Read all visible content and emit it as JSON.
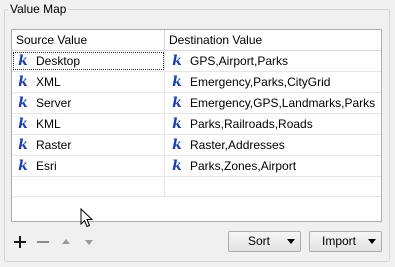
{
  "group": {
    "title": "Value Map"
  },
  "table": {
    "headers": {
      "source": "Source Value",
      "destination": "Destination Value"
    },
    "rows": [
      {
        "source": "Desktop",
        "destination": "GPS,Airport,Parks",
        "selected": true
      },
      {
        "source": "XML",
        "destination": "Emergency,Parks,CityGrid"
      },
      {
        "source": "Server",
        "destination": "Emergency,GPS,Landmarks,Parks"
      },
      {
        "source": "KML",
        "destination": "Parks,Railroads,Roads"
      },
      {
        "source": "Raster",
        "destination": "Raster,Addresses"
      },
      {
        "source": "Esri",
        "destination": "Parks,Zones,Airport"
      }
    ],
    "cell_icon": "constant-k-icon",
    "cell_icon_glyph": "k",
    "cell_icon_color": "#1d3fae"
  },
  "toolbar": {
    "add_icon": "plus-icon",
    "remove_icon": "minus-icon",
    "up_icon": "arrow-up-icon",
    "down_icon": "arrow-down-icon",
    "sort_label": "Sort",
    "import_label": "Import"
  },
  "colors": {
    "icon_blue": "#1d3fae",
    "disabled_gray": "#9a9a9a"
  }
}
